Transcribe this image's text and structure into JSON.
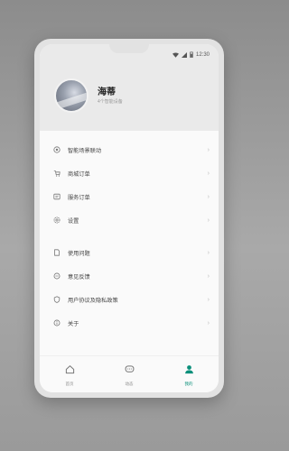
{
  "status": {
    "time": "12:30"
  },
  "profile": {
    "name": "海蒂",
    "subtitle": "4个智能设备"
  },
  "menu": {
    "group1": [
      {
        "label": "智能场景联动",
        "icon": "link-icon"
      },
      {
        "label": "商城订单",
        "icon": "cart-icon"
      },
      {
        "label": "服务订单",
        "icon": "service-order-icon"
      },
      {
        "label": "设置",
        "icon": "gear-icon"
      }
    ],
    "group2": [
      {
        "label": "使用问题",
        "icon": "doc-icon"
      },
      {
        "label": "意见反馈",
        "icon": "feedback-icon"
      },
      {
        "label": "用户协议及隐私政策",
        "icon": "shield-icon"
      },
      {
        "label": "关于",
        "icon": "info-icon"
      }
    ]
  },
  "tabbar": [
    {
      "label": "首页",
      "icon": "home-icon"
    },
    {
      "label": "动态",
      "icon": "chat-icon"
    },
    {
      "label": "我的",
      "icon": "person-icon",
      "active": true
    }
  ],
  "colors": {
    "accent": "#0a8f7a"
  }
}
